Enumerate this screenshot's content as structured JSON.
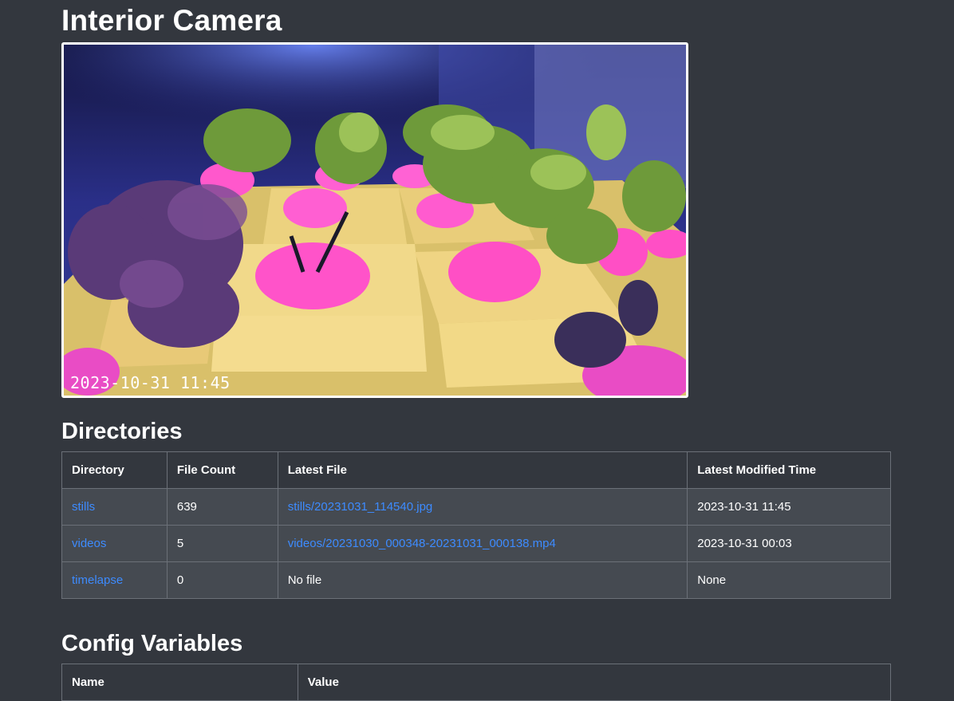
{
  "page": {
    "title": "Interior Camera",
    "timestamp": "2023-10-31 11:45"
  },
  "directories": {
    "heading": "Directories",
    "columns": [
      "Directory",
      "File Count",
      "Latest File",
      "Latest Modified Time"
    ],
    "rows": [
      {
        "directory": "stills",
        "file_count": "639",
        "latest_file": "stills/20231031_114540.jpg",
        "modified": "2023-10-31 11:45"
      },
      {
        "directory": "videos",
        "file_count": "5",
        "latest_file": "videos/20231030_000348-20231031_000138.mp4",
        "modified": "2023-10-31 00:03"
      },
      {
        "directory": "timelapse",
        "file_count": "0",
        "latest_file": "No file",
        "modified": "None"
      }
    ]
  },
  "config": {
    "heading": "Config Variables",
    "columns": [
      "Name",
      "Value"
    ]
  },
  "colors": {
    "background": "#33373e",
    "cell": "#454a51",
    "link": "#3d8bff"
  }
}
